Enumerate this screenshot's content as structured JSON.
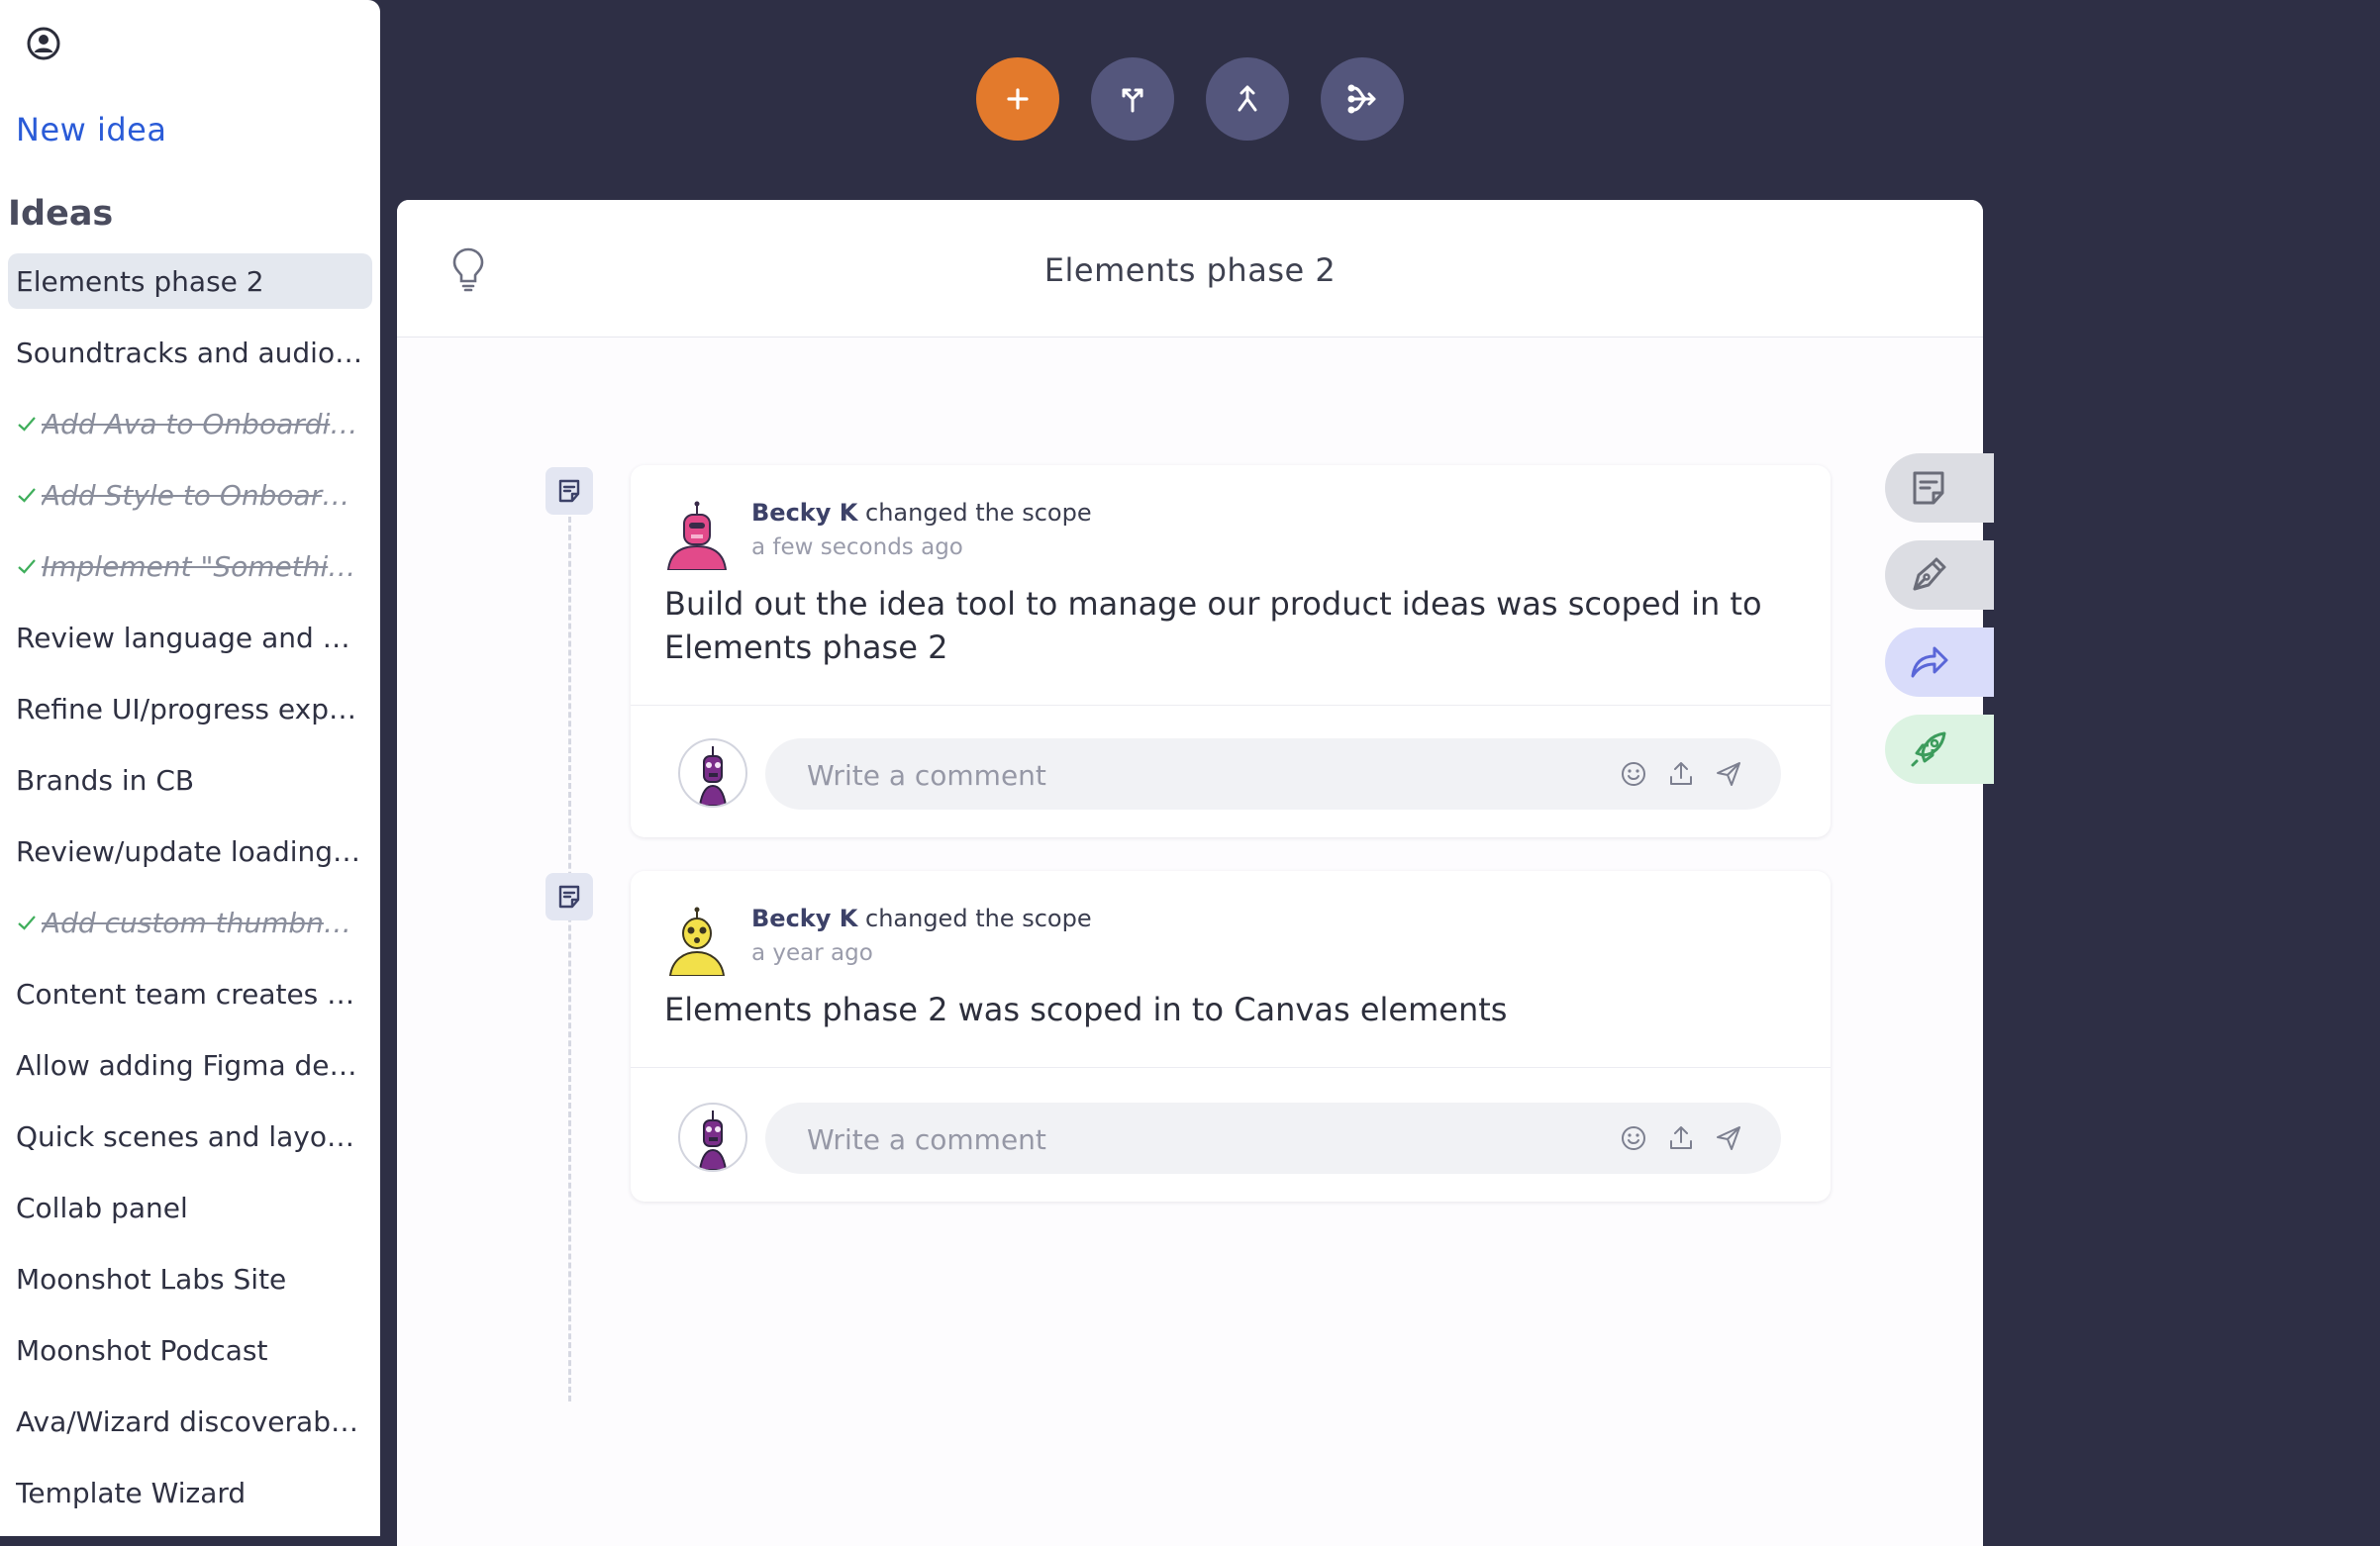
{
  "sidebar": {
    "new_idea_label": "New idea",
    "ideas_heading": "Ideas",
    "items": [
      {
        "label": "Elements phase 2",
        "active": true,
        "done": false
      },
      {
        "label": "Soundtracks and audio ...",
        "active": false,
        "done": false
      },
      {
        "label": "Add Ava to Onboarding",
        "active": false,
        "done": true
      },
      {
        "label": "Add Style to Onboardi...",
        "active": false,
        "done": true
      },
      {
        "label": "Implement \"Somethin...",
        "active": false,
        "done": true
      },
      {
        "label": "Review language and m...",
        "active": false,
        "done": false
      },
      {
        "label": "Refine UI/progress expe...",
        "active": false,
        "done": false
      },
      {
        "label": "Brands in CB",
        "active": false,
        "done": false
      },
      {
        "label": "Review/update loading ...",
        "active": false,
        "done": false
      },
      {
        "label": "Add custom thumbna...",
        "active": false,
        "done": true
      },
      {
        "label": "Content team creates c...",
        "active": false,
        "done": false
      },
      {
        "label": "Allow adding Figma des...",
        "active": false,
        "done": false
      },
      {
        "label": "Quick scenes and layouts",
        "active": false,
        "done": false
      },
      {
        "label": "Collab panel",
        "active": false,
        "done": false
      },
      {
        "label": "Moonshot Labs Site",
        "active": false,
        "done": false
      },
      {
        "label": "Moonshot Podcast",
        "active": false,
        "done": false
      },
      {
        "label": "Ava/Wizard discoverabil...",
        "active": false,
        "done": false
      },
      {
        "label": "Template Wizard",
        "active": false,
        "done": false
      }
    ]
  },
  "toolbar": {
    "buttons": [
      {
        "icon": "plus-icon",
        "color": "#e37a2c"
      },
      {
        "icon": "branch-split-icon",
        "color": "#54567c"
      },
      {
        "icon": "merge-icon",
        "color": "#54567c"
      },
      {
        "icon": "branch-tree-icon",
        "color": "#54567c"
      }
    ]
  },
  "panel": {
    "title": "Elements phase 2",
    "header_icon": "lightbulb-icon"
  },
  "activity": [
    {
      "user": "Becky K",
      "action": "changed the scope",
      "time": "a few seconds ago",
      "body": "Build out the idea tool to manage our product ideas was scoped in to Elements phase 2",
      "avatar": "pink-robot-avatar"
    },
    {
      "user": "Becky K",
      "action": "changed the scope",
      "time": "a year ago",
      "body": "Elements phase 2 was scoped in to Canvas elements",
      "avatar": "yellow-robot-avatar"
    }
  ],
  "comment": {
    "placeholder": "Write a comment"
  },
  "side_tabs": [
    {
      "icon": "note-icon",
      "bg": "#dcdde3"
    },
    {
      "icon": "pen-icon",
      "bg": "#dcdde3"
    },
    {
      "icon": "share-icon",
      "bg": "#d9dcfa"
    },
    {
      "icon": "rocket-icon",
      "bg": "#dcf3e2"
    }
  ],
  "colors": {
    "background": "#2e2f45",
    "accent_orange": "#e37a2c",
    "link_blue": "#2a5bd7",
    "done_green": "#3fae5b"
  }
}
